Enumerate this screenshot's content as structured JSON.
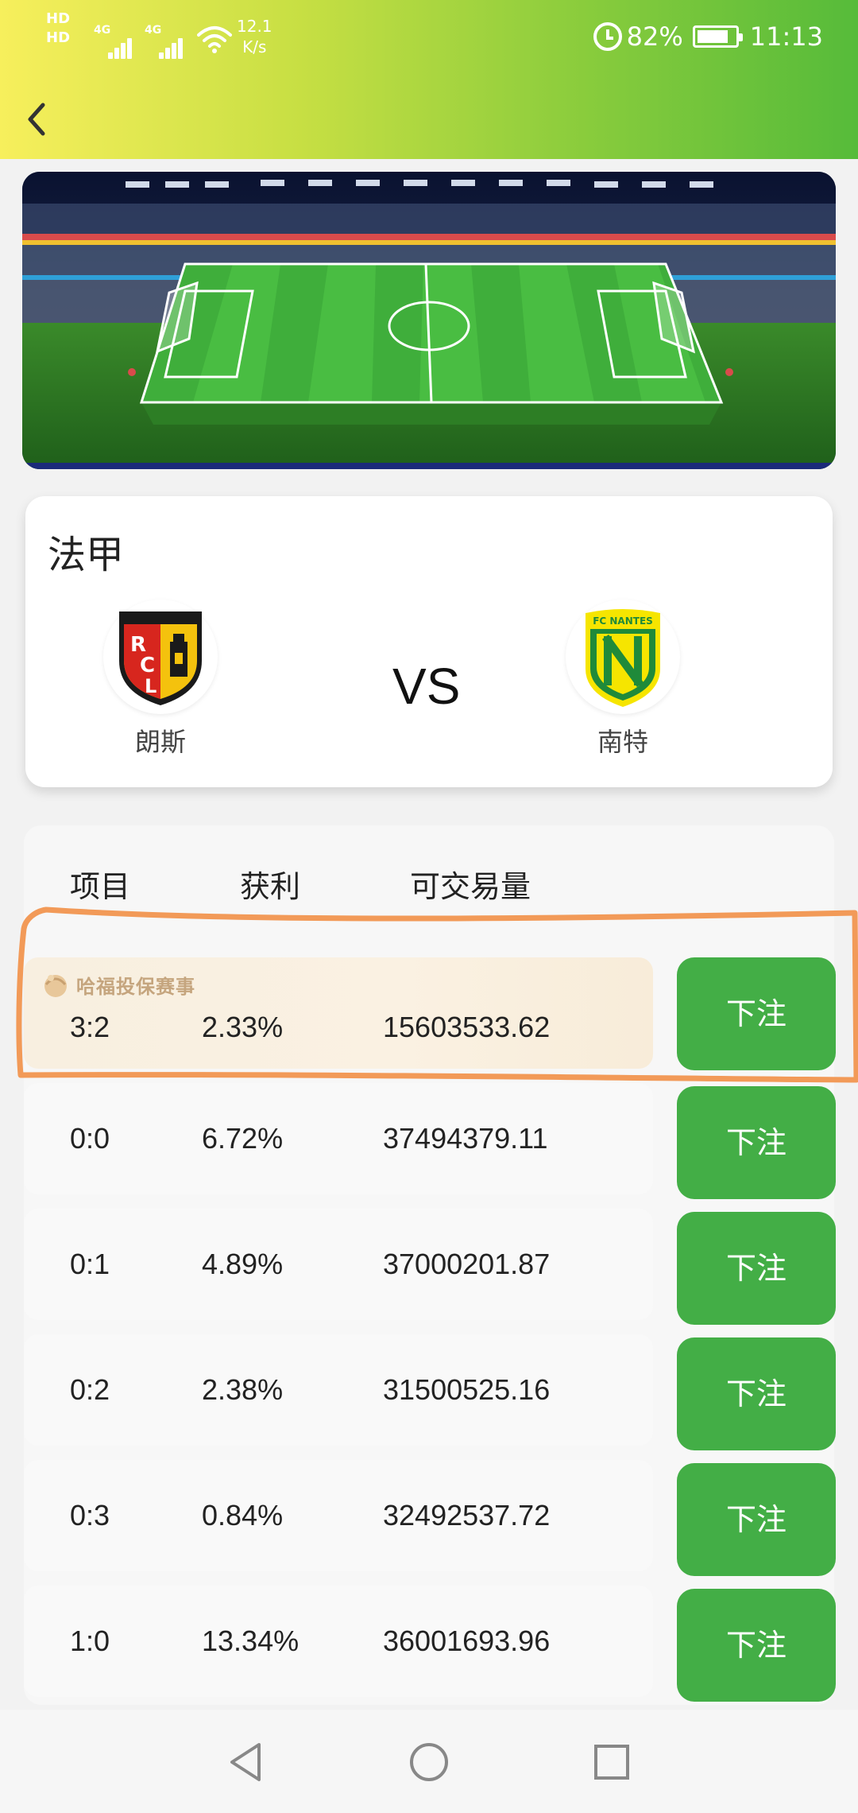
{
  "status": {
    "hd1": "HD",
    "hd2": "HD",
    "net1": "4G",
    "net2": "4G",
    "speed_value": "12.1",
    "speed_unit": "K/s",
    "battery": "82%",
    "battery_level": 0.82,
    "time": "11:13"
  },
  "match": {
    "league": "法甲",
    "vs": "VS",
    "home_team": "朗斯",
    "away_team": "南特",
    "home_logo_text": "RACING CLUB DE LENS",
    "away_logo_text": "FC NANTES"
  },
  "table": {
    "headers": {
      "item": "项目",
      "profit": "获利",
      "volume": "可交易量"
    },
    "promo_tag": "哈福投保赛事",
    "bet_label": "下注",
    "rows": [
      {
        "score": "3:2",
        "profit": "2.33%",
        "volume": "15603533.62"
      },
      {
        "score": "0:0",
        "profit": "6.72%",
        "volume": "37494379.11"
      },
      {
        "score": "0:1",
        "profit": "4.89%",
        "volume": "37000201.87"
      },
      {
        "score": "0:2",
        "profit": "2.38%",
        "volume": "31500525.16"
      },
      {
        "score": "0:3",
        "profit": "0.84%",
        "volume": "32492537.72"
      },
      {
        "score": "1:0",
        "profit": "13.34%",
        "volume": "36001693.96"
      }
    ]
  },
  "colors": {
    "accent_green": "#43ae46",
    "highlight_annotation": "#f29a58",
    "promo_tag": "#c5a57e"
  },
  "icons": {
    "back": "chevron-left-icon",
    "alarm": "alarm-icon",
    "battery": "battery-icon",
    "wifi": "wifi-icon",
    "nav_back": "triangle-back-icon",
    "nav_home": "circle-home-icon",
    "nav_recent": "square-recent-icon"
  }
}
